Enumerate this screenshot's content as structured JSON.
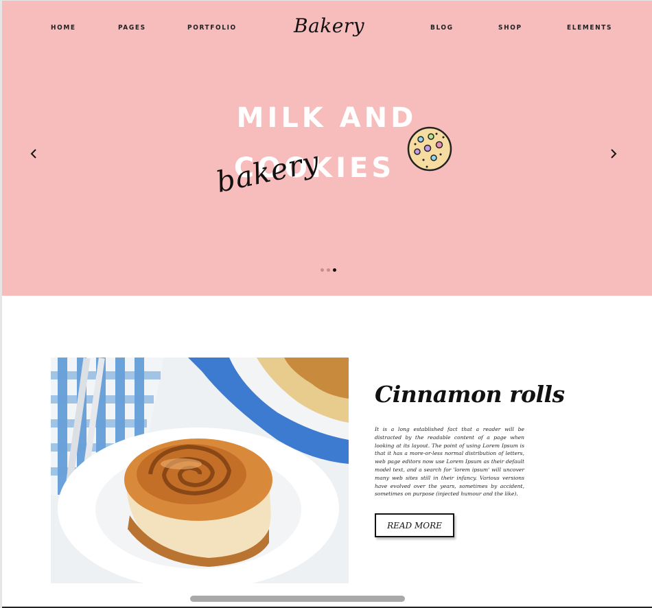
{
  "nav": {
    "left": [
      {
        "label": "HOME"
      },
      {
        "label": "PAGES"
      },
      {
        "label": "PORTFOLIO"
      }
    ],
    "logo": "Bakery",
    "right": [
      {
        "label": "BLOG"
      },
      {
        "label": "SHOP"
      },
      {
        "label": "ELEMENTS"
      }
    ]
  },
  "hero": {
    "headline_line1": "MILK AND",
    "headline_line2": "COOKIES",
    "script_word": "bakery",
    "prev_icon": "chevron-left-icon",
    "next_icon": "chevron-right-icon",
    "slide_count": 3,
    "active_slide": 3,
    "background_color": "#f7bcbc"
  },
  "article": {
    "title": "Cinnamon rolls",
    "body": "It is a long established fact that a reader will be distracted by the readable content of a page when looking at its layout. The point of using Lorem Ipsum is that it has a more-or-less normal distribution of letters, web page editors now use Lorem Ipsum as their default model text, and a search for 'lorem ipsum' will uncover many web sites still in their infancy. Various versions have evolved over the years, sometimes by accident, sometimes on purpose (injected humour and the like).",
    "button_label": "READ MORE"
  }
}
